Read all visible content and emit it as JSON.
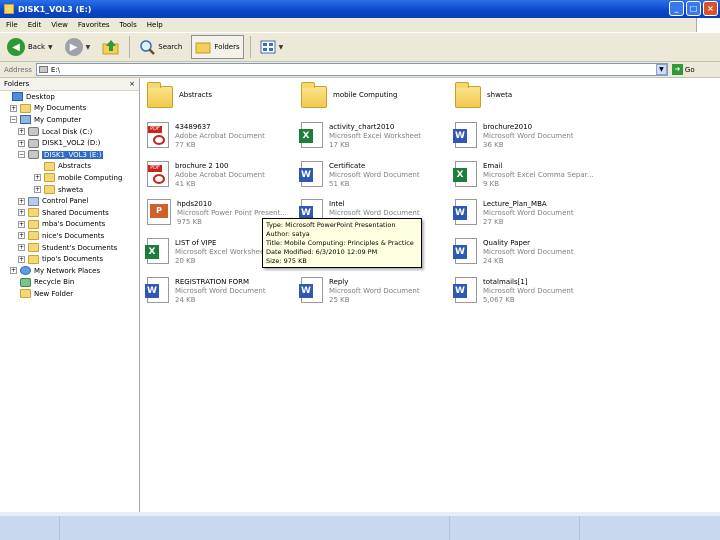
{
  "window": {
    "title": "DISK1_VOL3 (E:)"
  },
  "menu": [
    "File",
    "Edit",
    "View",
    "Favorites",
    "Tools",
    "Help"
  ],
  "toolbar": {
    "back": "Back",
    "search": "Search",
    "folders": "Folders"
  },
  "address": {
    "label": "Address",
    "value": "E:\\",
    "go": "Go"
  },
  "folders_pane": {
    "title": "Folders",
    "close": "×",
    "tree": [
      {
        "label": "Desktop",
        "icon": "desktop-icon",
        "expander": ""
      },
      {
        "label": "My Documents",
        "icon": "folder-icon",
        "expander": "+"
      },
      {
        "label": "My Computer",
        "icon": "computer-icon",
        "expander": "−"
      },
      {
        "label": "Local Disk (C:)",
        "icon": "drive-icon",
        "expander": "+"
      },
      {
        "label": "DISK1_VOL2 (D:)",
        "icon": "drive-icon",
        "expander": "+"
      },
      {
        "label": "DISK1_VOL3 (E:)",
        "icon": "drive-icon",
        "expander": "−",
        "selected": true
      },
      {
        "label": "Abstracts",
        "icon": "folder-icon",
        "expander": ""
      },
      {
        "label": "mobile Computing",
        "icon": "folder-icon",
        "expander": "+"
      },
      {
        "label": "shweta",
        "icon": "folder-icon",
        "expander": "+"
      },
      {
        "label": "Control Panel",
        "icon": "control-panel-icon",
        "expander": "+"
      },
      {
        "label": "Shared Documents",
        "icon": "folder-icon",
        "expander": "+"
      },
      {
        "label": "mba's Documents",
        "icon": "folder-icon",
        "expander": "+"
      },
      {
        "label": "nice's Documents",
        "icon": "folder-icon",
        "expander": "+"
      },
      {
        "label": "Student's Documents",
        "icon": "folder-icon",
        "expander": "+"
      },
      {
        "label": "tipo's Documents",
        "icon": "folder-icon",
        "expander": "+"
      },
      {
        "label": "My Network Places",
        "icon": "network-icon",
        "expander": "+"
      },
      {
        "label": "Recycle Bin",
        "icon": "recycle-bin-icon",
        "expander": ""
      },
      {
        "label": "New Folder",
        "icon": "folder-icon",
        "expander": ""
      }
    ]
  },
  "files": [
    {
      "name": "Abstracts",
      "kind": "folder"
    },
    {
      "name": "mobile Computing",
      "kind": "folder"
    },
    {
      "name": "shweta",
      "kind": "folder"
    },
    {
      "name": "43489637",
      "type": "Adobe Acrobat Document",
      "size": "77 KB",
      "kind": "pdf"
    },
    {
      "name": "activity_chart2010",
      "type": "Microsoft Excel Worksheet",
      "size": "17 KB",
      "kind": "excel"
    },
    {
      "name": "brochure2010",
      "type": "Microsoft Word Document",
      "size": "36 KB",
      "kind": "word"
    },
    {
      "name": "brochure 2 100",
      "type": "Adobe Acrobat Document",
      "size": "41 KB",
      "kind": "pdf"
    },
    {
      "name": "Certificate",
      "type": "Microsoft Word Document",
      "size": "51 KB",
      "kind": "word"
    },
    {
      "name": "Email",
      "type": "Microsoft Excel Comma Separ...",
      "size": "9 KB",
      "kind": "excel"
    },
    {
      "name": "hpds2010",
      "type": "Microsoft Power Point Present...",
      "size": "975 KB",
      "kind": "ppt"
    },
    {
      "name": "Intel",
      "type": "Microsoft Word Document",
      "size": "",
      "kind": "word"
    },
    {
      "name": "Lecture_Plan_MBA",
      "type": "Microsoft Word Document",
      "size": "27 KB",
      "kind": "word"
    },
    {
      "name": "LIST of VIPE",
      "type": "Microsoft Excel Worksheet",
      "size": "20 KB",
      "kind": "excel"
    },
    {
      "name": "",
      "type": "",
      "size": "",
      "kind": "word"
    },
    {
      "name": "Quality Paper",
      "type": "Microsoft Word Document",
      "size": "24 KB",
      "kind": "word"
    },
    {
      "name": "REGISTRATION FORM",
      "type": "Microsoft Word Document",
      "size": "24 KB",
      "kind": "word"
    },
    {
      "name": "Reply",
      "type": "Microsoft Word Document",
      "size": "25 KB",
      "kind": "word"
    },
    {
      "name": "totalmails[1]",
      "type": "Microsoft Word Document",
      "size": "5,067 KB",
      "kind": "word"
    }
  ],
  "tooltip": {
    "line1": "Type: Microsoft PowerPoint Presentation",
    "line2": "Author: satya",
    "line3": "Title: Mobile Computing: Principles & Practice",
    "line4": "Date Modified: 6/3/2010 12:09 PM",
    "line5": "Size: 975 KB"
  }
}
